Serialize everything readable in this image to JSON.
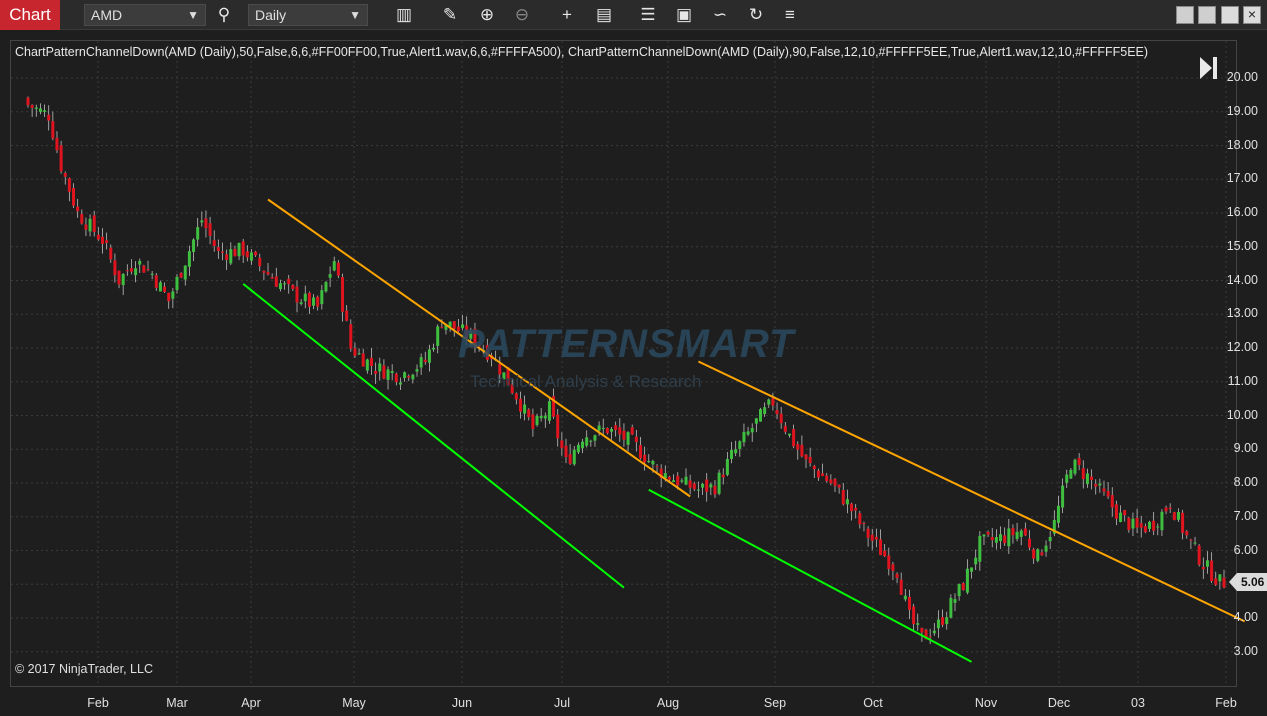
{
  "toolbar": {
    "chart_tab": "Chart",
    "instrument": "AMD",
    "interval": "Daily",
    "tools": [
      "bar-type-icon",
      "pencil-icon",
      "zoom-in-icon",
      "zoom-out-icon",
      "crosshair-icon",
      "data-box-icon",
      "properties-icon",
      "templates-icon",
      "drawing-tools-icon",
      "reload-icon",
      "list-icon"
    ]
  },
  "chart": {
    "indicator_label": "ChartPatternChannelDown(AMD (Daily),50,False,6,6,#FF00FF00,True,Alert1.wav,6,6,#FFFFA500), ChartPatternChannelDown(AMD (Daily),90,False,12,10,#FFFFF5EE,True,Alert1.wav,12,10,#FFFFF5EE)",
    "copyright": "© 2017 NinjaTrader, LLC",
    "watermark_title": "PATTERNSMART",
    "watermark_subtitle": "Technical Analysis & Research",
    "last_price": "5.06",
    "price_labels": [
      "20.00",
      "19.00",
      "18.00",
      "17.00",
      "16.00",
      "15.00",
      "14.00",
      "13.00",
      "12.00",
      "11.00",
      "10.00",
      "9.00",
      "8.00",
      "7.00",
      "6.00",
      "5.00",
      "4.00",
      "3.00"
    ],
    "date_labels": [
      "Feb",
      "Mar",
      "Apr",
      "May",
      "Jun",
      "Jul",
      "Aug",
      "Sep",
      "Oct",
      "Nov",
      "Dec",
      "03",
      "Feb"
    ],
    "colors": {
      "up": "#3fbf3f",
      "down": "#e0141e",
      "resistance": "#ffa500",
      "support": "#00ff00",
      "grid": "#3a3a3a"
    }
  },
  "chart_data": {
    "type": "candlestick",
    "ylim": [
      2.7,
      20.7
    ],
    "ticks": [
      20,
      19,
      18,
      17,
      16,
      15,
      14,
      13,
      12,
      11,
      10,
      9,
      8,
      7,
      6,
      5,
      4,
      3
    ],
    "close_path": [
      [
        0,
        19.2
      ],
      [
        5,
        18.9
      ],
      [
        8,
        17.4
      ],
      [
        12,
        16.0
      ],
      [
        18,
        15.2
      ],
      [
        22,
        14.0
      ],
      [
        26,
        14.6
      ],
      [
        30,
        14.2
      ],
      [
        34,
        13.4
      ],
      [
        38,
        14.6
      ],
      [
        42,
        15.8
      ],
      [
        46,
        14.8
      ],
      [
        52,
        14.9
      ],
      [
        58,
        14.2
      ],
      [
        64,
        13.6
      ],
      [
        70,
        13.2
      ],
      [
        74,
        14.6
      ],
      [
        78,
        12.0
      ],
      [
        84,
        11.4
      ],
      [
        90,
        11.2
      ],
      [
        96,
        11.6
      ],
      [
        100,
        12.8
      ],
      [
        106,
        12.4
      ],
      [
        112,
        11.8
      ],
      [
        118,
        10.6
      ],
      [
        122,
        9.6
      ],
      [
        126,
        10.2
      ],
      [
        130,
        8.6
      ],
      [
        134,
        9.4
      ],
      [
        140,
        9.6
      ],
      [
        146,
        9.2
      ],
      [
        152,
        8.4
      ],
      [
        158,
        8.0
      ],
      [
        162,
        7.8
      ],
      [
        166,
        7.9
      ],
      [
        170,
        8.8
      ],
      [
        176,
        9.8
      ],
      [
        180,
        10.4
      ],
      [
        184,
        9.4
      ],
      [
        188,
        8.6
      ],
      [
        194,
        8.0
      ],
      [
        198,
        7.4
      ],
      [
        202,
        6.6
      ],
      [
        206,
        6.0
      ],
      [
        210,
        5.4
      ],
      [
        213,
        4.0
      ],
      [
        216,
        3.4
      ],
      [
        220,
        3.8
      ],
      [
        226,
        5.0
      ],
      [
        230,
        6.2
      ],
      [
        236,
        6.4
      ],
      [
        240,
        6.6
      ],
      [
        244,
        5.8
      ],
      [
        248,
        6.8
      ],
      [
        252,
        8.6
      ],
      [
        256,
        8.2
      ],
      [
        260,
        7.6
      ],
      [
        264,
        7.0
      ],
      [
        268,
        6.6
      ],
      [
        272,
        6.8
      ],
      [
        276,
        7.4
      ],
      [
        280,
        6.4
      ],
      [
        284,
        5.6
      ],
      [
        288,
        5.06
      ]
    ],
    "channels": [
      {
        "name": "",
        "color": "resistance",
        "from": [
          58,
          16.4
        ],
        "to": [
          160,
          7.6
        ]
      },
      {
        "name": "",
        "color": "support",
        "from": [
          52,
          13.9
        ],
        "to": [
          144,
          4.9
        ]
      },
      {
        "name": "",
        "color": "resistance",
        "from": [
          162,
          11.6
        ],
        "to": [
          294,
          3.9
        ]
      },
      {
        "name": "",
        "color": "support",
        "from": [
          150,
          7.8
        ],
        "to": [
          228,
          2.7
        ]
      }
    ],
    "n_bars": 290
  }
}
